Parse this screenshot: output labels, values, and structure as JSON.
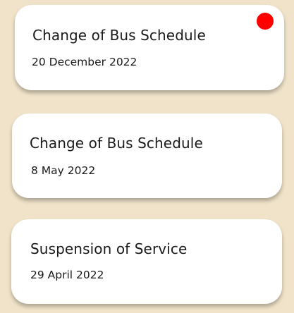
{
  "notices": [
    {
      "title": "Change of Bus Schedule",
      "date": "20 December 2022",
      "unread": true
    },
    {
      "title": "Change of Bus Schedule",
      "date": "8 May 2022",
      "unread": false
    },
    {
      "title": "Suspension of Service",
      "date": "29 April 2022",
      "unread": false
    }
  ],
  "colors": {
    "background": "#f0e3c9",
    "card": "#ffffff",
    "unread_indicator": "#ff0000"
  }
}
